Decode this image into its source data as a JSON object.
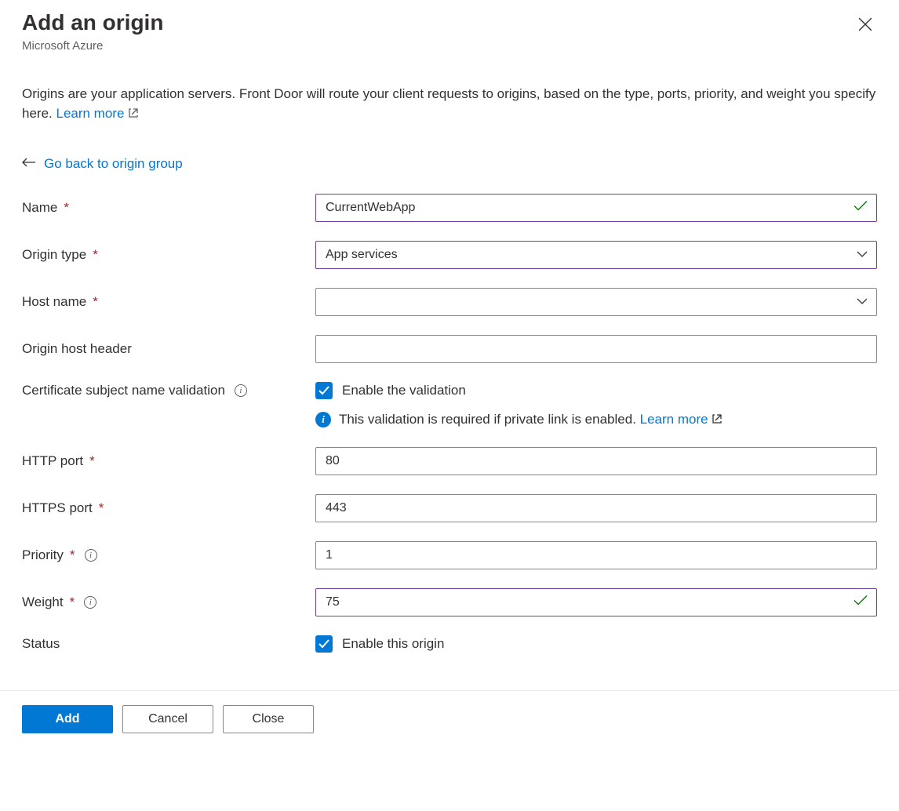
{
  "header": {
    "title": "Add an origin",
    "subtitle": "Microsoft Azure"
  },
  "description": {
    "text": "Origins are your application servers. Front Door will route your client requests to origins, based on the type, ports, priority, and weight you specify here. ",
    "learn_more": "Learn more"
  },
  "back_link": "Go back to origin group",
  "fields": {
    "name": {
      "label": "Name",
      "value": "CurrentWebApp"
    },
    "origin_type": {
      "label": "Origin type",
      "value": "App services"
    },
    "host_name": {
      "label": "Host name",
      "value": ""
    },
    "origin_host_header": {
      "label": "Origin host header",
      "value": ""
    },
    "cert_validation": {
      "label": "Certificate subject name validation",
      "checkbox_label": "Enable the validation",
      "checked": true
    },
    "info_message": {
      "text": "This validation is required if private link is enabled. ",
      "learn_more": "Learn more"
    },
    "http_port": {
      "label": "HTTP port",
      "value": "80"
    },
    "https_port": {
      "label": "HTTPS port",
      "value": "443"
    },
    "priority": {
      "label": "Priority",
      "value": "1"
    },
    "weight": {
      "label": "Weight",
      "value": "75"
    },
    "status": {
      "label": "Status",
      "checkbox_label": "Enable this origin",
      "checked": true
    }
  },
  "buttons": {
    "add": "Add",
    "cancel": "Cancel",
    "close": "Close"
  }
}
